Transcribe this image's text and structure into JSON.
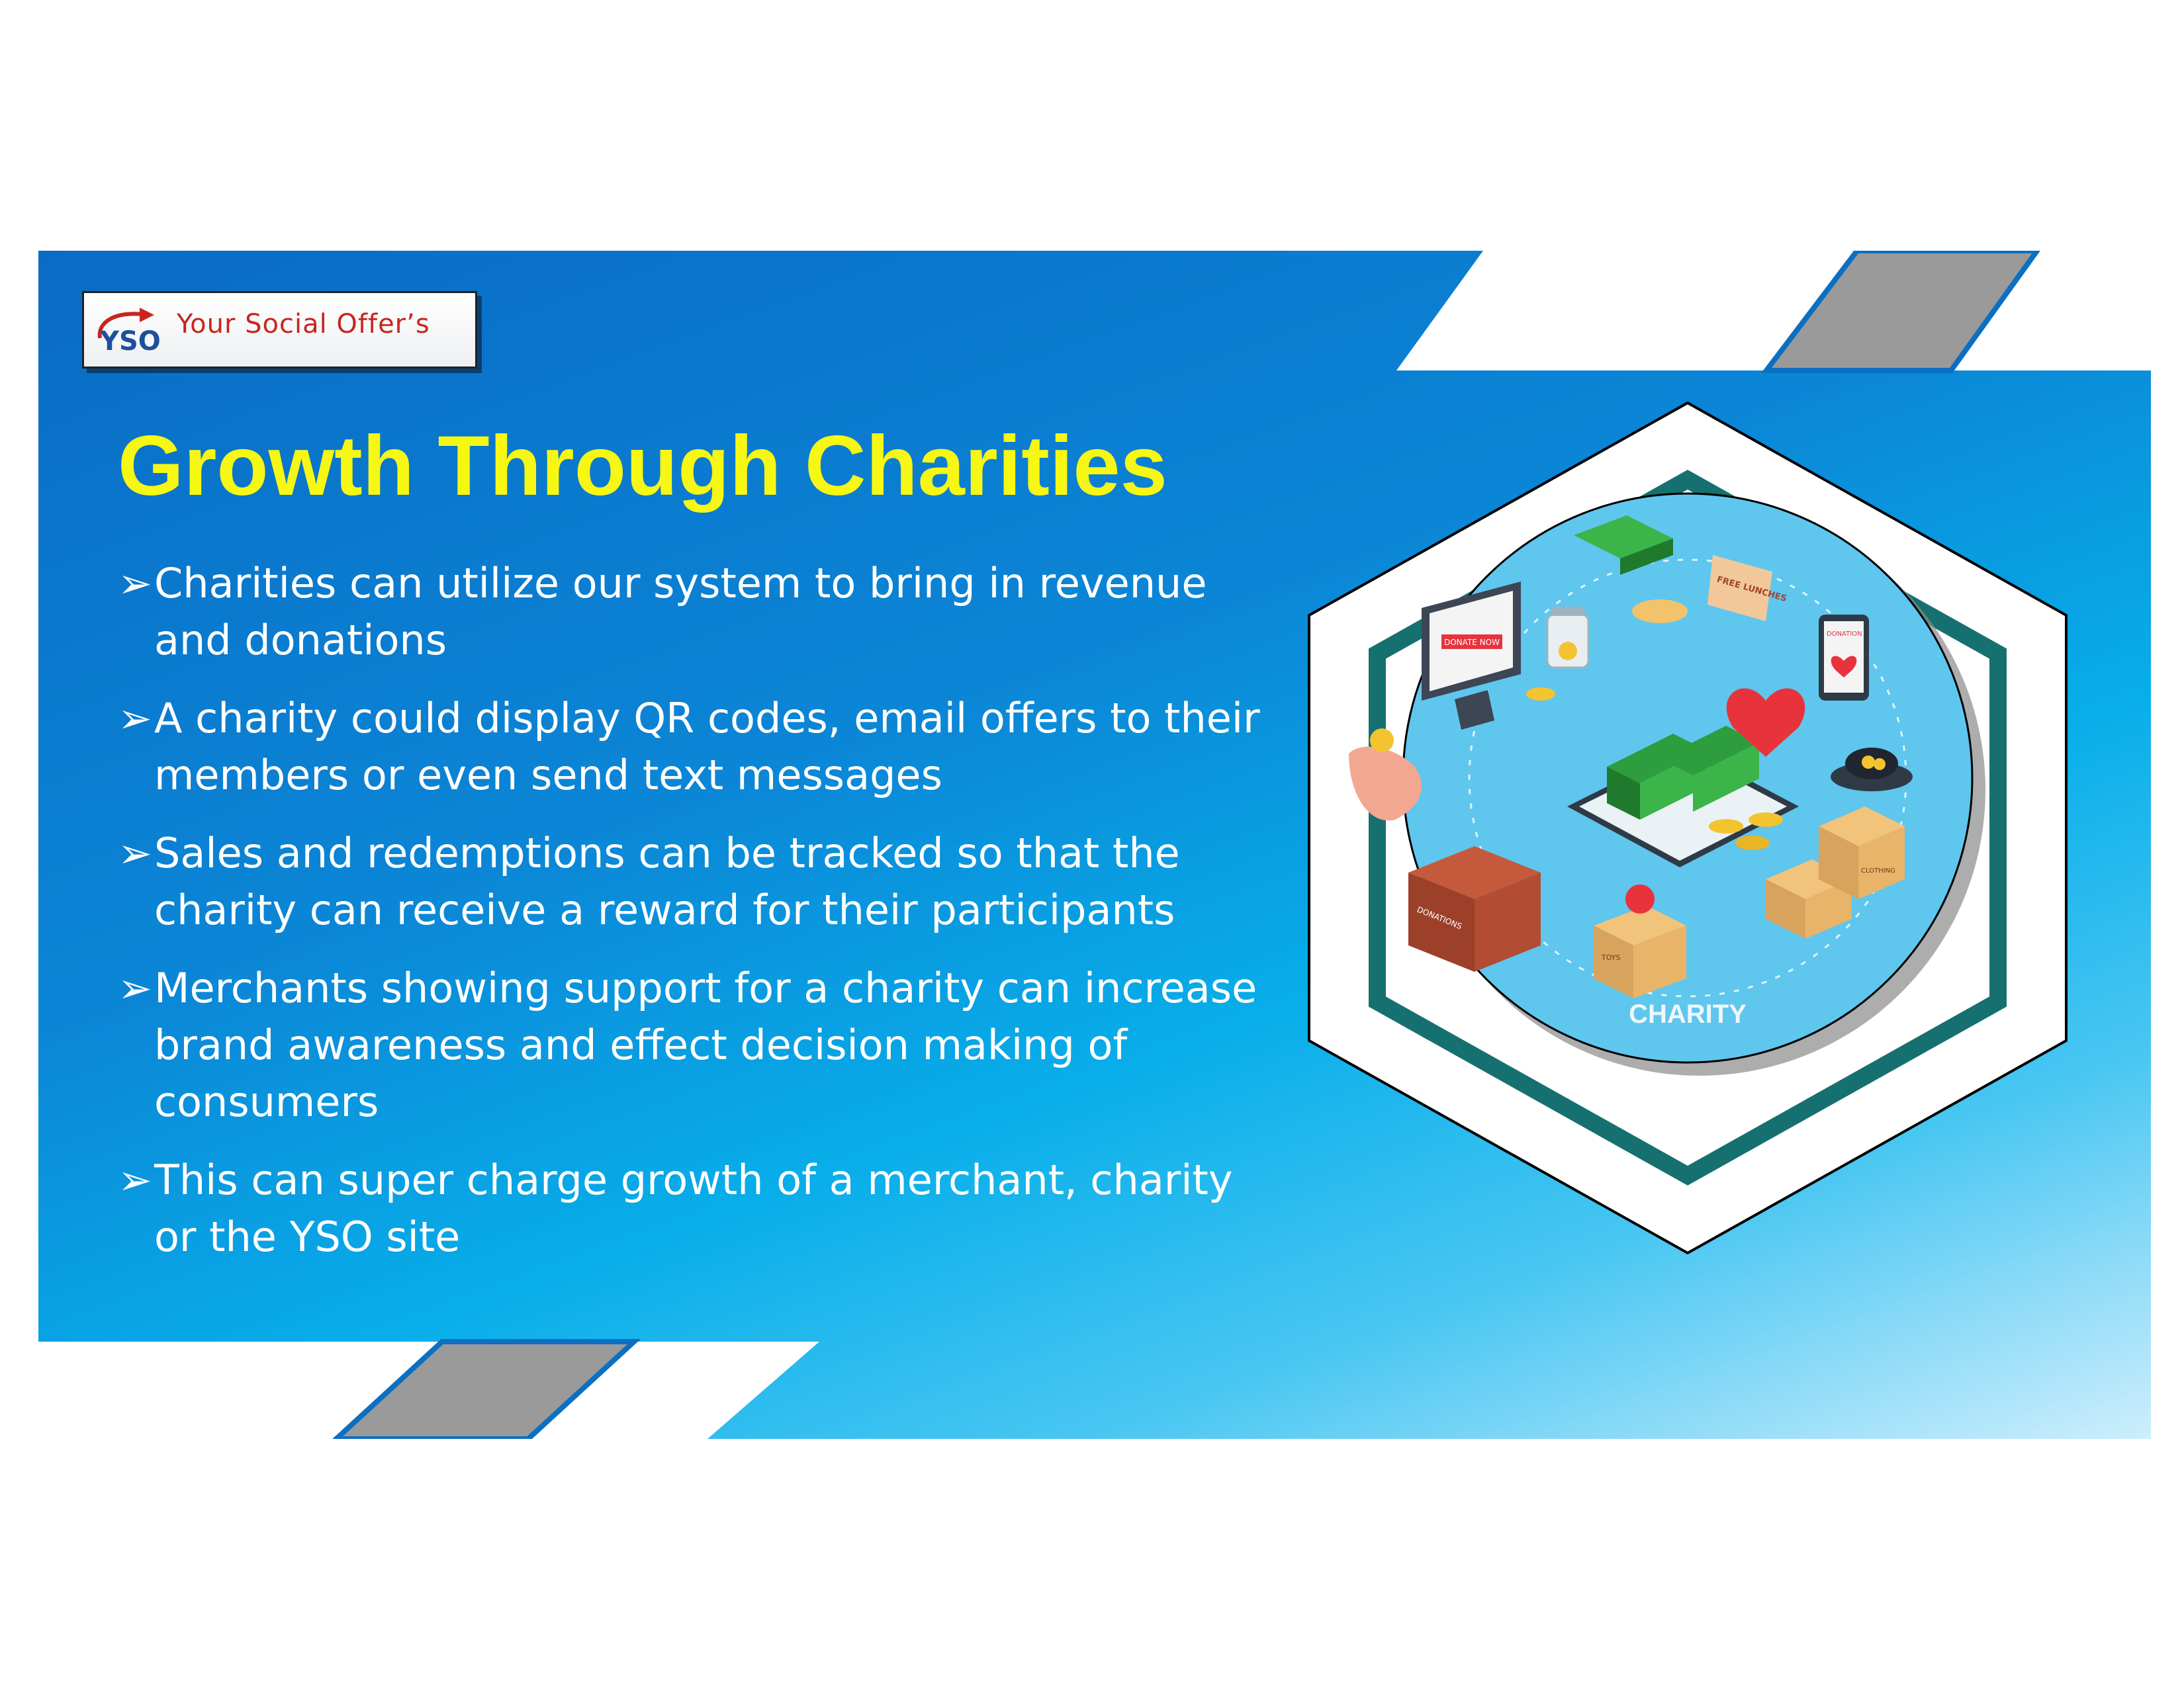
{
  "logo": {
    "badge": "YSO",
    "text": "Your Social Offer’s"
  },
  "title": "Growth Through Charities",
  "bullets": [
    "Charities can utilize our system to bring in revenue and donations",
    "A charity could display QR codes, email offers to their members or even send text messages",
    "Sales and redemptions can be tracked so that the charity can receive a reward for their participants",
    "Merchants showing support for a charity can increase brand awareness and effect decision making of consumers",
    "This can super charge growth of a merchant, charity or the YSO site"
  ],
  "bullet_glyph": "➢",
  "illustration": {
    "caption": "CHARITY",
    "donate_label": "DONATE NOW",
    "lunch_sign": "FREE LUNCHES",
    "donation_screen": "DONATION",
    "box_label": "DONATIONS",
    "toys_label": "TOYS",
    "clothing_label": "CLOTHING"
  },
  "colors": {
    "background_blue": "#0b86d6",
    "title_yellow": "#f7f714",
    "hex_teal": "#16706f",
    "logo_red": "#c8261e",
    "logo_blue": "#1d4f9c",
    "stripe_gray": "#9a9a9a"
  }
}
